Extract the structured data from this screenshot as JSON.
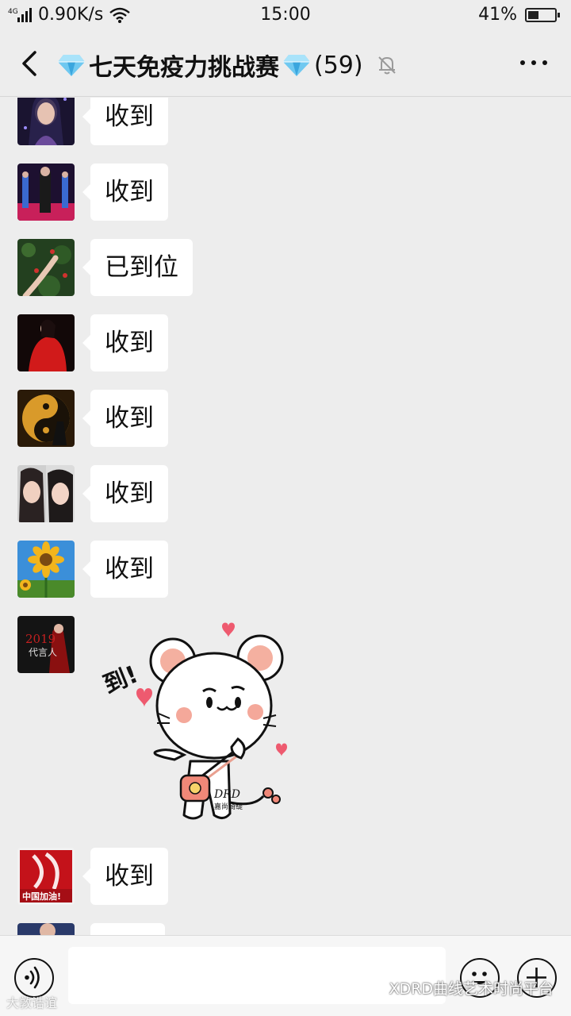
{
  "status": {
    "network": "4G",
    "speed": "0.90K/s",
    "time": "15:00",
    "battery": "41%",
    "battery_level": 0.41
  },
  "header": {
    "title": "七天免疫力挑战赛",
    "member_count": "(59)",
    "back_icon": "back-chevron-icon",
    "mute_icon": "bell-muted-icon",
    "more_icon": "more-dots-icon"
  },
  "messages": [
    {
      "text": "收到"
    },
    {
      "text": "收到"
    },
    {
      "text": "已到位"
    },
    {
      "text": "收到"
    },
    {
      "text": "收到"
    },
    {
      "text": "收到"
    },
    {
      "text": "收到"
    },
    {
      "sticker": "到!",
      "sticker_brand": "DRD",
      "sticker_sub": "嘉尚琦缇",
      "avatar_text_1": "2019",
      "avatar_text_2": "代言人"
    },
    {
      "text": "收到",
      "avatar_text": "中国加油!"
    },
    {
      "text": ""
    }
  ],
  "input": {
    "voice_icon": "voice-icon",
    "emoji_icon": "emoji-icon",
    "plus_icon": "plus-icon",
    "value": ""
  },
  "watermark": {
    "left": "大敦诰谊",
    "right": "XDRD曲线艺术时尚平台"
  },
  "colors": {
    "background": "#ededed",
    "bubble": "#ffffff",
    "heart": "#ee5a6f"
  }
}
